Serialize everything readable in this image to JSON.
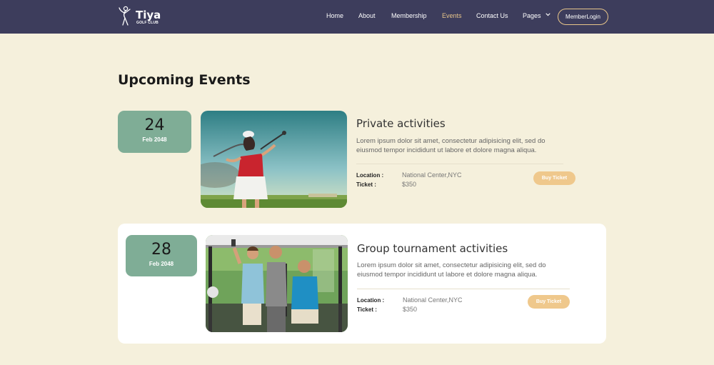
{
  "brand": {
    "name": "Tiya",
    "tagline": "GOLF CLUB"
  },
  "nav": {
    "items": [
      {
        "label": "Home"
      },
      {
        "label": "About"
      },
      {
        "label": "Membership"
      },
      {
        "label": "Events"
      },
      {
        "label": "Contact Us"
      },
      {
        "label": "Pages"
      }
    ],
    "active": "Events",
    "login_label": "MemberLogin"
  },
  "colors": {
    "navbar": "#3d3d5c",
    "page_bg": "#f5f0dc",
    "accent": "#e7c58a",
    "date_box": "#7fad96",
    "ticket_button": "#efc88c"
  },
  "section": {
    "title": "Upcoming Events"
  },
  "events": [
    {
      "day": "24",
      "month": "Feb 2048",
      "title": "Private activities",
      "description": "Lorem ipsum dolor sit amet, consectetur adipisicing elit, sed do eiusmod tempor incididunt ut labore et dolore magna aliqua.",
      "location_label": "Location :",
      "location": "National Center,NYC",
      "ticket_label": "Ticket :",
      "ticket_price": "$350",
      "button_label": "Buy Ticket"
    },
    {
      "day": "28",
      "month": "Feb 2048",
      "title": "Group tournament activities",
      "description": "Lorem ipsum dolor sit amet, consectetur adipisicing elit, sed do eiusmod tempor incididunt ut labore et dolore magna aliqua.",
      "location_label": "Location :",
      "location": "National Center,NYC",
      "ticket_label": "Ticket :",
      "ticket_price": "$350",
      "button_label": "Buy Ticket"
    }
  ]
}
